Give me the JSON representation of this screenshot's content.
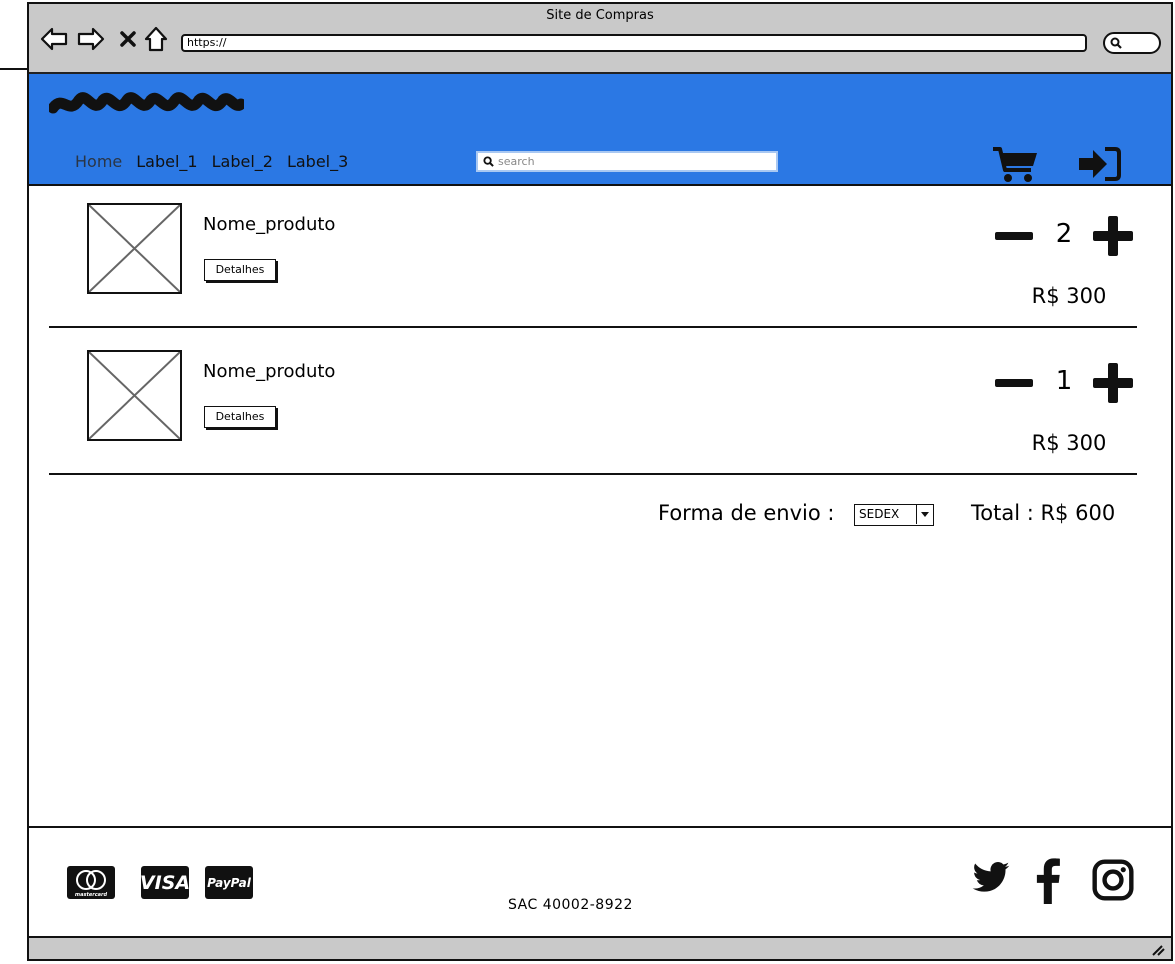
{
  "window": {
    "title": "Site de Compras",
    "url": "https://"
  },
  "nav": {
    "items": [
      "Home",
      "Label_1",
      "Label_2",
      "Label_3"
    ]
  },
  "search": {
    "placeholder": "search"
  },
  "cart_items": [
    {
      "name": "Nome_produto",
      "details_label": "Detalhes",
      "quantity": "2",
      "price": "R$ 300"
    },
    {
      "name": "Nome_produto",
      "details_label": "Detalhes",
      "quantity": "1",
      "price": "R$ 300"
    }
  ],
  "shipping": {
    "label": "Forma de envio :",
    "selected": "SEDEX"
  },
  "total": {
    "text": "Total : R$ 600"
  },
  "footer": {
    "payments": [
      "mastercard",
      "VISA",
      "PayPal"
    ],
    "sac": "SAC 40002-8922",
    "social_icons": [
      "twitter-icon",
      "facebook-icon",
      "instagram-icon"
    ]
  },
  "colors": {
    "header": "#2b78e4",
    "chrome": "#c9c9c9"
  }
}
